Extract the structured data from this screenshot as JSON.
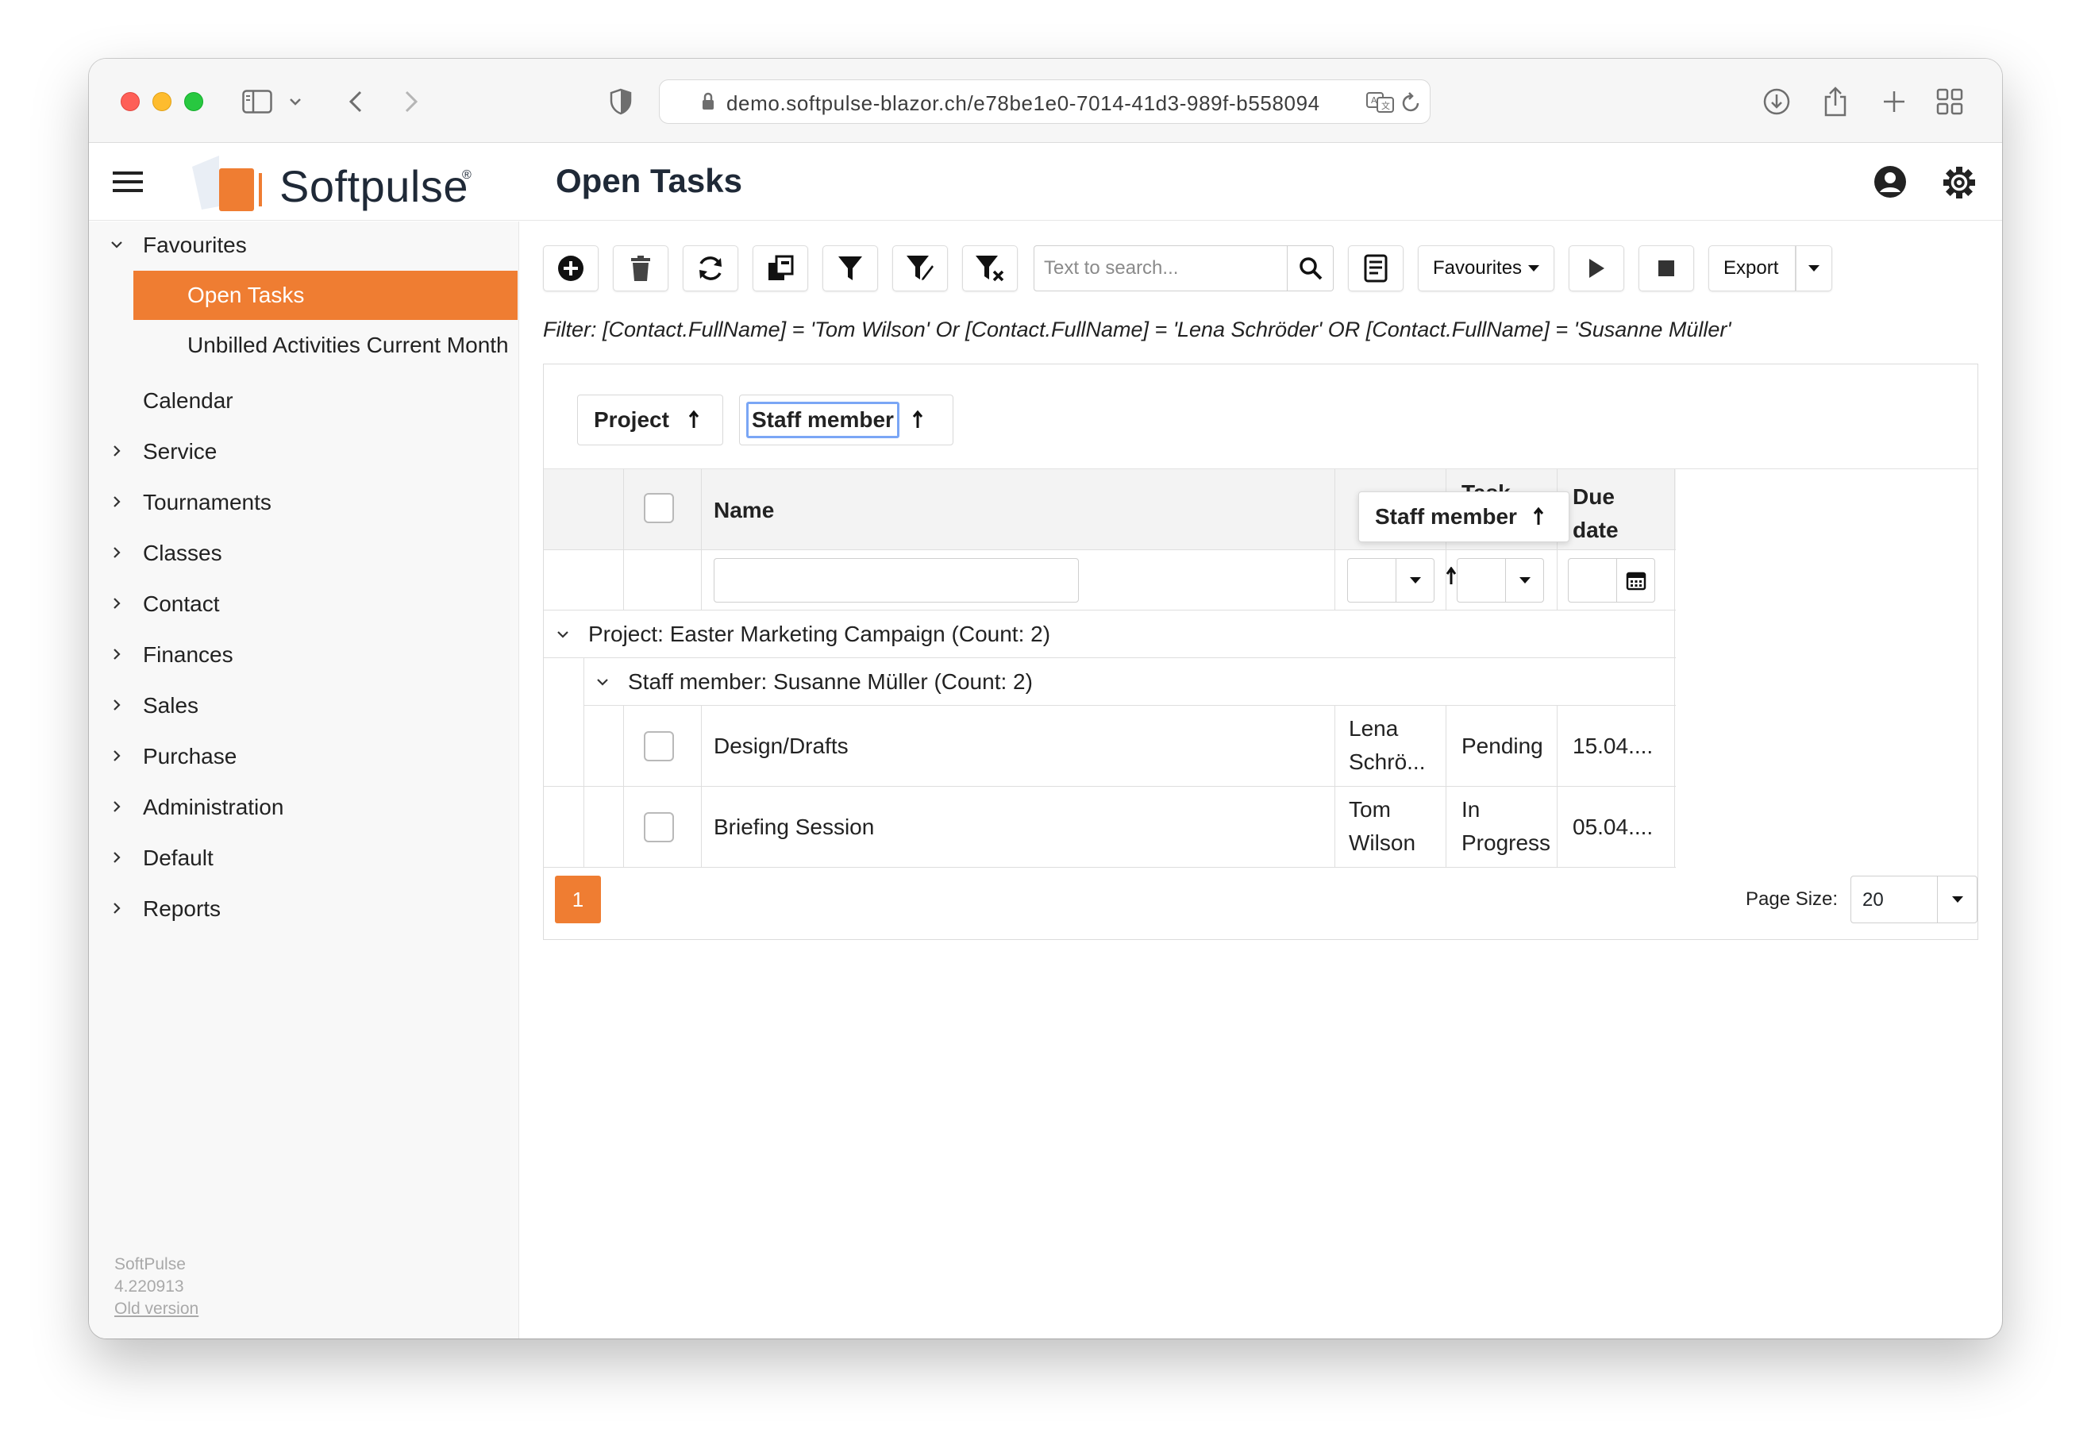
{
  "browser": {
    "url": "demo.softpulse-blazor.ch/e78be1e0-7014-41d3-989f-b558094"
  },
  "app": {
    "logo_text": "Softpulse",
    "page_title": "Open Tasks"
  },
  "sidebar": {
    "favourites_label": "Favourites",
    "favourites_items": [
      "Open Tasks",
      "Unbilled Activities Current Month"
    ],
    "calendar_label": "Calendar",
    "items": [
      "Service",
      "Tournaments",
      "Classes",
      "Contact",
      "Finances",
      "Sales",
      "Purchase",
      "Administration",
      "Default",
      "Reports"
    ],
    "footer": {
      "app_name": "SoftPulse",
      "version": "4.220913",
      "old_version_link": "Old version"
    }
  },
  "toolbar": {
    "search_placeholder": "Text to search...",
    "favourites_label": "Favourites",
    "export_label": "Export"
  },
  "filter_text": "Filter: [Contact.FullName] = 'Tom Wilson' Or [Contact.FullName] = 'Lena Schröder' OR [Contact.FullName] = 'Susanne Müller'",
  "grid": {
    "group_chips": [
      "Project",
      "Staff member"
    ],
    "headers": {
      "name": "Name",
      "task": "Task",
      "due_date": "Due date",
      "due_line1": "Due",
      "due_line2": "date"
    },
    "drag_chip": "Staff member",
    "group_rows": [
      "Project: Easter Marketing Campaign (Count: 2)",
      "Staff member: Susanne Müller (Count: 2)"
    ],
    "rows": [
      {
        "name": "Design/Drafts",
        "staff_l1": "Lena",
        "staff_l2": "Schrö...",
        "status_l1": "Pending",
        "status_l2": "",
        "due": "15.04...."
      },
      {
        "name": "Briefing Session",
        "staff_l1": "Tom",
        "staff_l2": "Wilson",
        "status_l1": "In",
        "status_l2": "Progress",
        "due": "05.04...."
      }
    ],
    "pager": {
      "current_page": "1",
      "page_size_label": "Page Size:",
      "page_size": "20"
    }
  },
  "colors": {
    "accent": "#ef7d32",
    "focus": "#7aa6f5"
  }
}
